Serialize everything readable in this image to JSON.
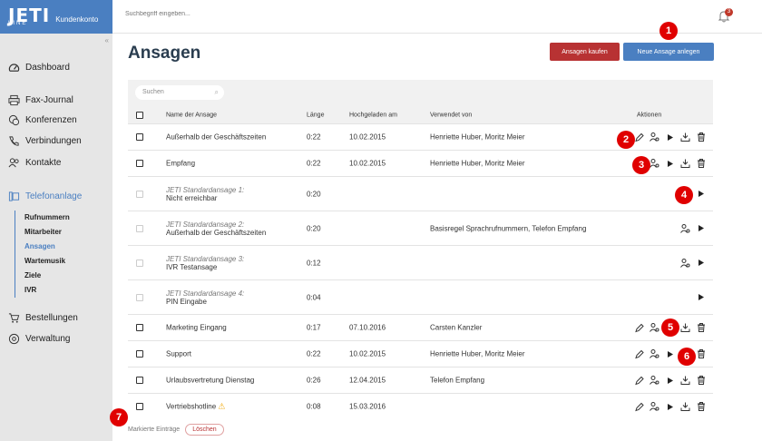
{
  "brand": {
    "name": "JETI",
    "sub": "LINE",
    "account": "Kundenkonto"
  },
  "topbar": {
    "search_placeholder": "Suchbegriff eingeben...",
    "notification_count": "3"
  },
  "sidebar": {
    "items": [
      {
        "label": "Dashboard",
        "icon": "dashboard-icon"
      },
      {
        "label": "Fax-Journal",
        "icon": "printer-icon"
      },
      {
        "label": "Konferenzen",
        "icon": "conference-icon"
      },
      {
        "label": "Verbindungen",
        "icon": "phone-icon"
      },
      {
        "label": "Kontakte",
        "icon": "contacts-icon"
      },
      {
        "label": "Telefonanlage",
        "icon": "phone-system-icon"
      },
      {
        "label": "Bestellungen",
        "icon": "cart-icon"
      },
      {
        "label": "Verwaltung",
        "icon": "at-icon"
      }
    ],
    "subitems": [
      "Rufnummern",
      "Mitarbeiter",
      "Ansagen",
      "Wartemusik",
      "Ziele",
      "IVR"
    ]
  },
  "page": {
    "title": "Ansagen",
    "buy_label": "Ansagen kaufen",
    "new_label": "Neue Ansage anlegen",
    "search_placeholder": "Suchen"
  },
  "table": {
    "headers": [
      "Name der Ansage",
      "Länge",
      "Hochgeladen am",
      "Verwendet von",
      "Aktionen"
    ],
    "rows": [
      {
        "name": "Außerhalb der Geschäftszeiten",
        "length": "0:22",
        "date": "10.02.2015",
        "used": "Henriette Huber, Moritz Meier"
      },
      {
        "name": "Empfang",
        "length": "0:22",
        "date": "10.02.2015",
        "used": "Henriette Huber, Moritz Meier"
      },
      {
        "std": "JETI Standardansage 1:",
        "name": "Nicht erreichbar",
        "length": "0:20",
        "date": "",
        "used": ""
      },
      {
        "std": "JETI Standardansage 2:",
        "name": "Außerhalb der Geschäftszeiten",
        "length": "0:20",
        "date": "",
        "used": "Basisregel Sprachrufnummern, Telefon Empfang"
      },
      {
        "std": "JETI Standardansage 3:",
        "name": "IVR Testansage",
        "length": "0:12",
        "date": "",
        "used": ""
      },
      {
        "std": "JETI Standardansage 4:",
        "name": "PIN Eingabe",
        "length": "0:04",
        "date": "",
        "used": ""
      },
      {
        "name": "Marketing Eingang",
        "length": "0:17",
        "date": "07.10.2016",
        "used": "Carsten Kanzler"
      },
      {
        "name": "Support",
        "length": "0:22",
        "date": "10.02.2015",
        "used": "Henriette Huber, Moritz Meier"
      },
      {
        "name": "Urlaubsvertretung Dienstag",
        "length": "0:26",
        "date": "12.04.2015",
        "used": "Telefon Empfang"
      },
      {
        "name": "Vertriebshotline",
        "length": "0:08",
        "date": "15.03.2016",
        "used": ""
      }
    ]
  },
  "footer": {
    "marked": "Markierte Einträge",
    "delete": "Löschen"
  },
  "markers": [
    "1",
    "2",
    "3",
    "4",
    "5",
    "6",
    "7"
  ],
  "colors": {
    "primary": "#4a7fc1",
    "danger": "#b83233",
    "marker": "#e00000"
  }
}
